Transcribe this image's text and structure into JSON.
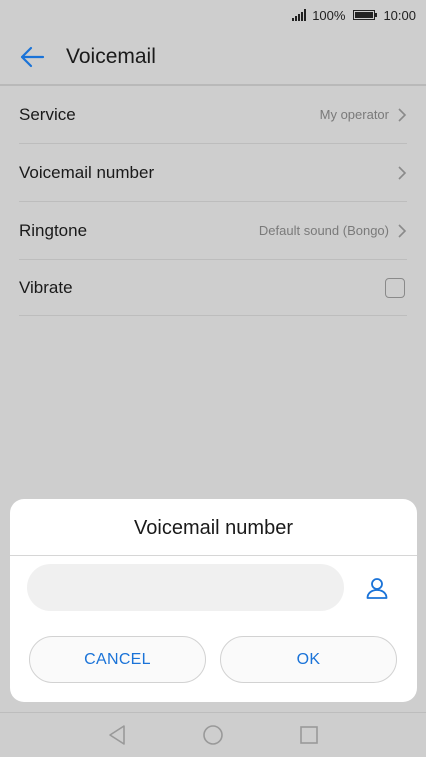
{
  "status": {
    "battery_text": "100%",
    "time": "10:00",
    "battery_level": 1.0
  },
  "header": {
    "title": "Voicemail",
    "back_icon": "back-arrow-icon"
  },
  "settings": [
    {
      "label": "Service",
      "value": "My operator"
    },
    {
      "label": "Voicemail number",
      "value": ""
    },
    {
      "label": "Ringtone",
      "value": "Default sound (Bongo)"
    },
    {
      "label": "Vibrate",
      "checked": false
    }
  ],
  "dialog": {
    "title": "Voicemail number",
    "input_value": "",
    "contact_icon": "person-icon",
    "cancel_label": "CANCEL",
    "ok_label": "OK"
  },
  "colors": {
    "accent": "#1a73d8",
    "scrim": "#cecece"
  },
  "nav": [
    "back-triangle-icon",
    "home-circle-icon",
    "recents-square-icon"
  ]
}
